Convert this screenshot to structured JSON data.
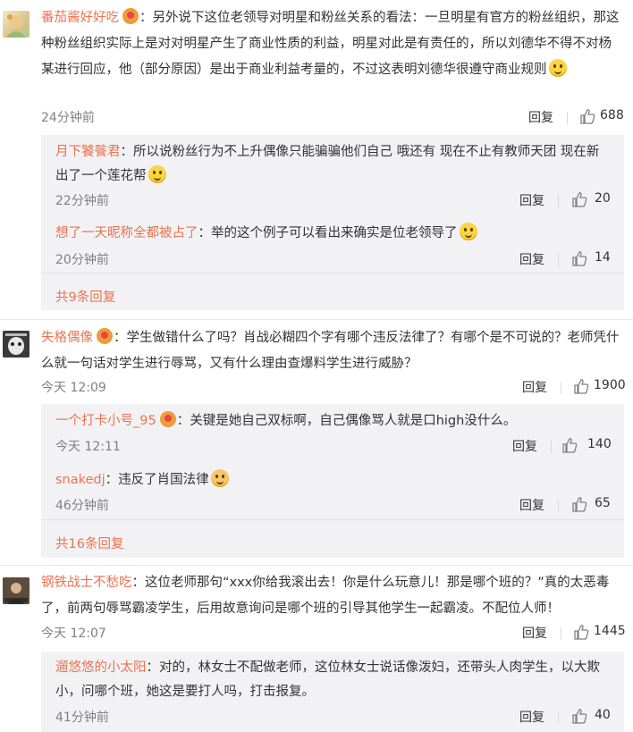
{
  "comments": [
    {
      "user": "番茄酱好好吃",
      "text": "：另外说下这位老领导对明星和粉丝关系的看法：一旦明星有官方的粉丝组织，那这种粉丝组织实际上是对对明星产生了商业性质的利益，明星对此是有责任的，所以刘德华不得不对杨某进行回应，他（部分原因）是出于商业利益考量的，不过这表明刘德华很遵守商业规则",
      "time": "24分钟前",
      "reply": "回复",
      "likes": "688",
      "replies": [
        {
          "user": "月下饕餮君",
          "text": "：所以说粉丝行为不上升偶像只能骗骗他们自己 哦还有 现在不止有教师天团 现在新出了一个莲花帮",
          "time": "22分钟前",
          "reply": "回复",
          "likes": "20"
        },
        {
          "user": "想了一天昵称全都被占了",
          "text": "：举的这个例子可以看出来确实是位老领导了",
          "time": "20分钟前",
          "reply": "回复",
          "likes": "14"
        }
      ],
      "more": "共9条回复"
    },
    {
      "user": "失格偶像",
      "text": "：学生做错什么了吗？肖战必糊四个字有哪个违反法律了？有哪个是不可说的？老师凭什么就一句话对学生进行辱骂，又有什么理由查爆料学生进行威胁？",
      "time": "今天 12:09",
      "reply": "回复",
      "likes": "1900",
      "replies": [
        {
          "user": "一个打卡小号_95",
          "text": "：关键是她自己双标啊，自己偶像骂人就是口high没什么。",
          "time": "今天 12:11",
          "reply": "回复",
          "likes": "140"
        },
        {
          "user": "snakedj",
          "text": "：违反了肖国法律",
          "time": "46分钟前",
          "reply": "回复",
          "likes": "65"
        }
      ],
      "more": "共16条回复"
    },
    {
      "user": "钢铁战士不愁吃",
      "text": "：这位老师那句“xxx你给我滚出去！你是什么玩意儿！那是哪个班的？”真的太恶毒了，前两句辱骂霸凌学生，后用故意询问是哪个班的引导其他学生一起霸凌。不配位人师！",
      "time": "今天 12:07",
      "reply": "回复",
      "likes": "1445",
      "replies": [
        {
          "user": "遛悠悠的小太阳",
          "text": "：对的，林女士不配做老师，这位林女士说话像泼妇，还带头人肉学生，以大欺小，问哪个班，她这是要打人吗，打击报复。",
          "time": "41分钟前",
          "reply": "回复",
          "likes": "40"
        }
      ]
    }
  ],
  "colors": {
    "username": "#eb7350",
    "subbox_bg": "#f2f2f5",
    "meta": "#808080"
  }
}
